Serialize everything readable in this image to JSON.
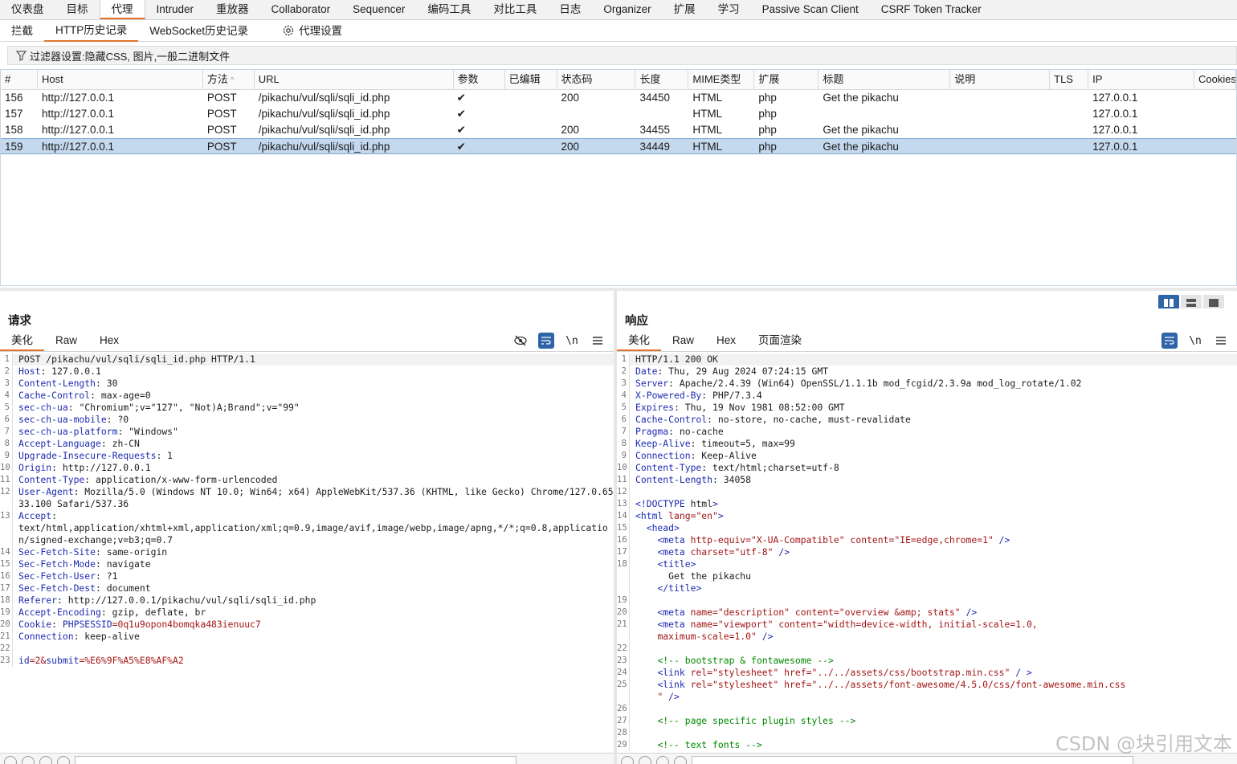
{
  "menu": [
    "仪表盘",
    "目标",
    "代理",
    "Intruder",
    "重放器",
    "Collaborator",
    "Sequencer",
    "编码工具",
    "对比工具",
    "日志",
    "Organizer",
    "扩展",
    "学习",
    "Passive Scan Client",
    "CSRF Token Tracker"
  ],
  "subtabs": [
    "拦截",
    "HTTP历史记录",
    "WebSocket历史记录",
    "代理设置"
  ],
  "filter": "过滤器设置:隐藏CSS, 图片,一般二进制文件",
  "table": {
    "headers": [
      "#",
      "Host",
      "方法",
      "URL",
      "参数",
      "已编辑",
      "状态码",
      "长度",
      "MIME类型",
      "扩展",
      "标题",
      "说明",
      "TLS",
      "IP",
      "Cookies"
    ],
    "rows": [
      [
        "156",
        "http://127.0.0.1",
        "POST",
        "/pikachu/vul/sqli/sqli_id.php",
        "✔",
        "",
        "200",
        "34450",
        "HTML",
        "php",
        "Get the pikachu",
        "",
        "",
        "127.0.0.1",
        ""
      ],
      [
        "157",
        "http://127.0.0.1",
        "POST",
        "/pikachu/vul/sqli/sqli_id.php",
        "✔",
        "",
        "",
        "",
        "HTML",
        "php",
        "",
        "",
        "",
        "127.0.0.1",
        ""
      ],
      [
        "158",
        "http://127.0.0.1",
        "POST",
        "/pikachu/vul/sqli/sqli_id.php",
        "✔",
        "",
        "200",
        "34455",
        "HTML",
        "php",
        "Get the pikachu",
        "",
        "",
        "127.0.0.1",
        ""
      ],
      [
        "159",
        "http://127.0.0.1",
        "POST",
        "/pikachu/vul/sqli/sqli_id.php",
        "✔",
        "",
        "200",
        "34449",
        "HTML",
        "php",
        "Get the pikachu",
        "",
        "",
        "127.0.0.1",
        ""
      ]
    ],
    "selected_index": 3
  },
  "request": {
    "title": "请求",
    "tabs": [
      "美化",
      "Raw",
      "Hex"
    ],
    "lines": [
      {
        "n": "1",
        "t": "POST /pikachu/vul/sqli/sqli_id.php HTTP/1.1"
      },
      {
        "n": "2",
        "k": "Host",
        "v": " 127.0.0.1"
      },
      {
        "n": "3",
        "k": "Content-Length",
        "v": " 30"
      },
      {
        "n": "4",
        "k": "Cache-Control",
        "v": " max-age=0"
      },
      {
        "n": "5",
        "k": "sec-ch-ua",
        "v": " \"Chromium\";v=\"127\", \"Not)A;Brand\";v=\"99\""
      },
      {
        "n": "6",
        "k": "sec-ch-ua-mobile",
        "v": " ?0"
      },
      {
        "n": "7",
        "k": "sec-ch-ua-platform",
        "v": " \"Windows\""
      },
      {
        "n": "8",
        "k": "Accept-Language",
        "v": " zh-CN"
      },
      {
        "n": "9",
        "k": "Upgrade-Insecure-Requests",
        "v": " 1"
      },
      {
        "n": "10",
        "k": "Origin",
        "v": " http://127.0.0.1"
      },
      {
        "n": "11",
        "k": "Content-Type",
        "v": " application/x-www-form-urlencoded"
      },
      {
        "n": "12",
        "k": "User-Agent",
        "v": " Mozilla/5.0 (Windows NT 10.0; Win64; x64) AppleWebKit/537.36 (KHTML, like Gecko) Chrome/127.0.6533.100 Safari/537.36",
        "h": 2
      },
      {
        "n": "13",
        "k": "Accept",
        "v": "\ntext/html,application/xhtml+xml,application/xml;q=0.9,image/avif,image/webp,image/apng,*/*;q=0.8,application/signed-exchange;v=b3;q=0.7",
        "h": 3
      },
      {
        "n": "14",
        "k": "Sec-Fetch-Site",
        "v": " same-origin"
      },
      {
        "n": "15",
        "k": "Sec-Fetch-Mode",
        "v": " navigate"
      },
      {
        "n": "16",
        "k": "Sec-Fetch-User",
        "v": " ?1"
      },
      {
        "n": "17",
        "k": "Sec-Fetch-Dest",
        "v": " document"
      },
      {
        "n": "18",
        "k": "Referer",
        "v": " http://127.0.0.1/pikachu/vul/sqli/sqli_id.php"
      },
      {
        "n": "19",
        "k": "Accept-Encoding",
        "v": " gzip, deflate, br"
      },
      {
        "n": "20",
        "k": "Cookie",
        "v": " ",
        "ck": "PHPSESSID",
        "cv": "=0q1u9opon4bomqka483ienuuc7"
      },
      {
        "n": "21",
        "k": "Connection",
        "v": " keep-alive"
      },
      {
        "n": "22",
        "t": ""
      },
      {
        "n": "23",
        "body": [
          [
            "id",
            "=2&"
          ],
          [
            "submit",
            "=%E6%9F%A5%E8%AF%A2"
          ]
        ]
      }
    ]
  },
  "response": {
    "title": "响应",
    "tabs": [
      "美化",
      "Raw",
      "Hex",
      "页面渲染"
    ],
    "lines": [
      {
        "n": "1",
        "t": "HTTP/1.1 200 OK"
      },
      {
        "n": "2",
        "k": "Date",
        "v": " Thu, 29 Aug 2024 07:24:15 GMT"
      },
      {
        "n": "3",
        "k": "Server",
        "v": " Apache/2.4.39 (Win64) OpenSSL/1.1.1b mod_fcgid/2.3.9a mod_log_rotate/1.02"
      },
      {
        "n": "4",
        "k": "X-Powered-By",
        "v": " PHP/7.3.4"
      },
      {
        "n": "5",
        "k": "Expires",
        "v": " Thu, 19 Nov 1981 08:52:00 GMT"
      },
      {
        "n": "6",
        "k": "Cache-Control",
        "v": " no-store, no-cache, must-revalidate"
      },
      {
        "n": "7",
        "k": "Pragma",
        "v": " no-cache"
      },
      {
        "n": "8",
        "k": "Keep-Alive",
        "v": " timeout=5, max=99"
      },
      {
        "n": "9",
        "k": "Connection",
        "v": " Keep-Alive"
      },
      {
        "n": "10",
        "k": "Content-Type",
        "v": " text/html;charset=utf-8"
      },
      {
        "n": "11",
        "k": "Content-Length",
        "v": " 34058"
      },
      {
        "n": "12",
        "t": ""
      },
      {
        "n": "13",
        "html": "<!DOCTYPE html>"
      },
      {
        "n": "14",
        "html": "<html lang=\"en\">"
      },
      {
        "n": "15",
        "html": "  <head>"
      },
      {
        "n": "16",
        "html": "    <meta http-equiv=\"X-UA-Compatible\" content=\"IE=edge,chrome=1\" />"
      },
      {
        "n": "17",
        "html": "    <meta charset=\"utf-8\" />"
      },
      {
        "n": "18",
        "html": "    <title>\n      Get the pikachu\n    </title>",
        "h": 3
      },
      {
        "n": "19",
        "t": ""
      },
      {
        "n": "20",
        "html": "    <meta name=\"description\" content=\"overview &amp; stats\" />"
      },
      {
        "n": "21",
        "html": "    <meta name=\"viewport\" content=\"width=device-width, initial-scale=1.0,\n    maximum-scale=1.0\" />",
        "h": 2
      },
      {
        "n": "22",
        "t": ""
      },
      {
        "n": "23",
        "html": "    <!-- bootstrap & fontawesome -->"
      },
      {
        "n": "24",
        "html": "    <link rel=\"stylesheet\" href=\"../../assets/css/bootstrap.min.css\" / >"
      },
      {
        "n": "25",
        "html": "    <link rel=\"stylesheet\" href=\"../../assets/font-awesome/4.5.0/css/font-awesome.min.css\n    \" />",
        "h": 2
      },
      {
        "n": "26",
        "t": ""
      },
      {
        "n": "27",
        "html": "    <!-- page specific plugin styles -->"
      },
      {
        "n": "28",
        "t": ""
      },
      {
        "n": "29",
        "html": "    <!-- text fonts -->"
      }
    ]
  },
  "watermark": "CSDN @块引用文本",
  "icons": {
    "filter": "filter-icon",
    "settings": "gear-icon",
    "eye": "eye-off-icon",
    "wrap": "wrap-icon",
    "newline": "newline-icon",
    "menu": "hamburger-icon"
  }
}
